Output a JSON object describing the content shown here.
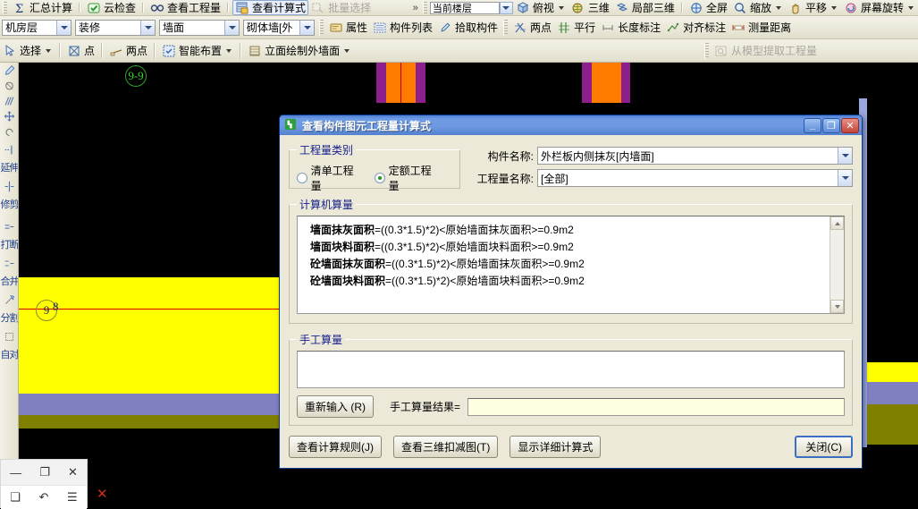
{
  "toolbars": {
    "row1": [
      {
        "name": "sigma-icon",
        "label": "汇总计算",
        "icon": "sigma"
      },
      {
        "name": "cloud-check",
        "label": "云检查",
        "icon": "cloudcheck"
      },
      {
        "name": "view-quantity",
        "label": "查看工程量",
        "icon": "binoculars"
      },
      {
        "name": "view-formula",
        "label": "查看计算式",
        "icon": "formula",
        "selected": true
      },
      {
        "name": "batch-select",
        "label": "批量选择",
        "icon": "batch",
        "disabled": true
      }
    ],
    "row1_overflow": "»",
    "row1_floor_combo": "当前楼层",
    "row1_right": [
      {
        "name": "top-view",
        "label": "俯视",
        "icon": "cube",
        "caret": true
      },
      {
        "name": "three-d",
        "label": "三维",
        "icon": "3d"
      },
      {
        "name": "local-three-d",
        "label": "局部三维",
        "icon": "local3d"
      },
      {
        "name": "fullscreen",
        "label": "全屏",
        "icon": "full"
      },
      {
        "name": "zoom",
        "label": "缩放",
        "icon": "mag",
        "caret": true
      },
      {
        "name": "pan",
        "label": "平移",
        "icon": "hand",
        "caret": true
      },
      {
        "name": "screen-rotate",
        "label": "屏幕旋转",
        "icon": "rotate",
        "caret": true
      }
    ],
    "row2_combos": [
      {
        "name": "floor-select",
        "value": "机房层"
      },
      {
        "name": "category-select",
        "value": "装修"
      },
      {
        "name": "element-select",
        "value": "墙面"
      },
      {
        "name": "member-select",
        "value": "砌体墙[外"
      }
    ],
    "row2_items": [
      {
        "name": "properties",
        "label": "属性",
        "icon": "props"
      },
      {
        "name": "member-list",
        "label": "构件列表",
        "icon": "list"
      },
      {
        "name": "pick-member",
        "label": "拾取构件",
        "icon": "pipette"
      }
    ],
    "row2_right": [
      {
        "name": "two-point",
        "label": "两点",
        "icon": "twopt"
      },
      {
        "name": "parallel",
        "label": "平行",
        "icon": "parallel"
      },
      {
        "name": "length-dim",
        "label": "长度标注",
        "icon": "lendim"
      },
      {
        "name": "align-dim",
        "label": "对齐标注",
        "icon": "aligndim"
      },
      {
        "name": "measure-distance",
        "label": "测量距离",
        "icon": "measure"
      }
    ],
    "row3_items": [
      {
        "name": "select",
        "label": "选择",
        "icon": "cursor",
        "caret": true
      },
      {
        "name": "point",
        "label": "点",
        "icon": "point"
      },
      {
        "name": "two-point-draw",
        "label": "两点",
        "icon": "twoptdraw"
      },
      {
        "name": "smart-layout",
        "label": "智能布置",
        "icon": "smart",
        "caret": true
      },
      {
        "name": "elevation-draw-wall",
        "label": "立面绘制外墙面",
        "icon": "elev",
        "caret": true
      }
    ],
    "row3_right": [
      {
        "name": "extract-from-model",
        "label": "从模型提取工程量",
        "icon": "extract",
        "disabled": true
      }
    ],
    "left_tools": [
      {
        "name": "brush-icon",
        "label": ""
      },
      {
        "name": "rotate-icon",
        "label": ""
      },
      {
        "name": "mirror-icon",
        "label": ""
      },
      {
        "name": "move-icon",
        "label": ""
      },
      {
        "name": "undo-arc-icon",
        "label": ""
      },
      {
        "name": "extend-icon",
        "label": "延伸"
      },
      {
        "name": "trim-icon",
        "label": "修剪"
      },
      {
        "name": "break-icon",
        "label": "打断"
      },
      {
        "name": "merge-icon",
        "label": "合并"
      },
      {
        "name": "split-icon",
        "label": "分割"
      },
      {
        "name": "auto-align-icon",
        "label": "自对"
      }
    ]
  },
  "canvas": {
    "axis_top_label": "9-9",
    "axis_left_label": "9",
    "axis_left_label2": "8",
    "colors": {
      "background": "#000000",
      "orange": "#ff7b00",
      "purple": "#8d1f8d",
      "yellow": "#ffff00",
      "blue_band": "#8080c0",
      "olive_band": "#808000",
      "red_line": "#d80000",
      "green_axis": "#33cc33"
    }
  },
  "dialog": {
    "title": "查看构件图元工程量计算式",
    "window_buttons": {
      "minimize": "_",
      "maximize": "❐",
      "close": "✕"
    },
    "quantity_type": {
      "legend": "工程量类别",
      "options": [
        {
          "label": "清单工程量",
          "selected": false
        },
        {
          "label": "定额工程量",
          "selected": true
        }
      ]
    },
    "fields": [
      {
        "label": "构件名称:",
        "value": "外栏板内侧抹灰[内墙面]"
      },
      {
        "label": "工程量名称:",
        "value": "[全部]"
      }
    ],
    "computer_calc": {
      "legend": "计算机算量",
      "rows": [
        {
          "name": "墙面抹灰面积",
          "expr": "=((0.3*1.5)*2)<原始墙面抹灰面积>=0.9m2"
        },
        {
          "name": "墙面块料面积",
          "expr": "=((0.3*1.5)*2)<原始墙面块料面积>=0.9m2"
        },
        {
          "name": "砼墙面抹灰面积",
          "expr": "=((0.3*1.5)*2)<原始墙面抹灰面积>=0.9m2"
        },
        {
          "name": "砼墙面块料面积",
          "expr": "=((0.3*1.5)*2)<原始墙面块料面积>=0.9m2"
        }
      ]
    },
    "manual_calc": {
      "legend": "手工算量",
      "textarea_value": "",
      "reinput_button": "重新输入 (R)",
      "result_label": "手工算量结果=",
      "result_value": ""
    },
    "buttons": [
      {
        "name": "view-calc-rule-button",
        "label": "查看计算规则(J)"
      },
      {
        "name": "view-3d-deduction-button",
        "label": "查看三维扣减图(T)"
      },
      {
        "name": "show-detailed-formula-button",
        "label": "显示详细计算式"
      },
      {
        "name": "close-button",
        "label": "关闭(C)",
        "default": true
      }
    ]
  },
  "mini_window": {
    "minimize": "—",
    "maximize": "❐",
    "close": "✕",
    "undo": "↶",
    "menu": "☰",
    "doc": "❑"
  }
}
